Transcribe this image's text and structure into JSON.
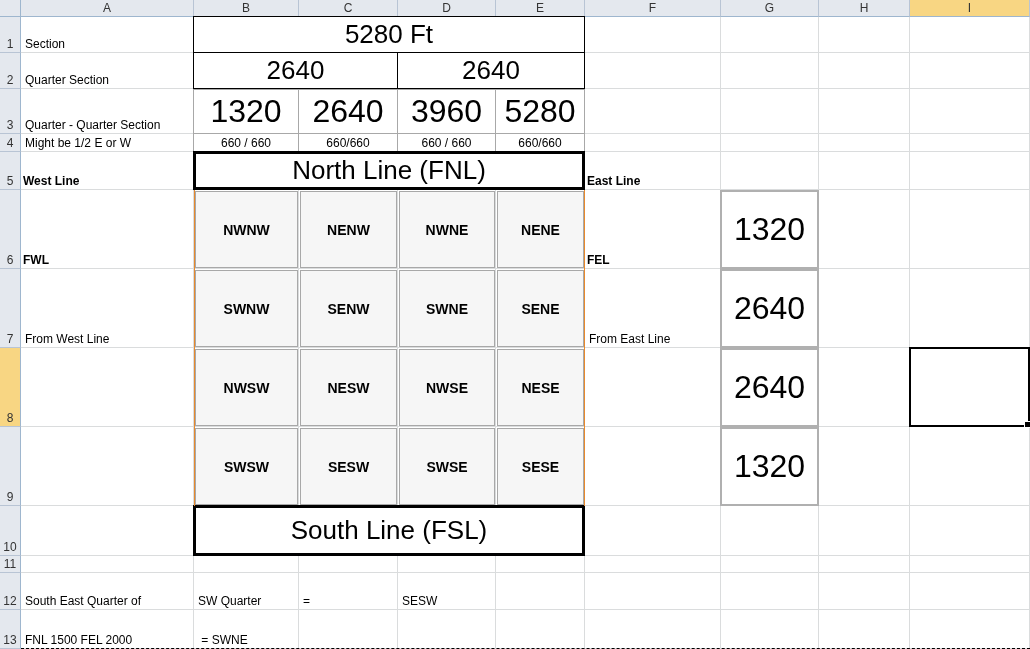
{
  "columns": [
    {
      "label": "A",
      "selected": false
    },
    {
      "label": "B",
      "selected": false
    },
    {
      "label": "C",
      "selected": false
    },
    {
      "label": "D",
      "selected": false
    },
    {
      "label": "E",
      "selected": false
    },
    {
      "label": "F",
      "selected": false
    },
    {
      "label": "G",
      "selected": false
    },
    {
      "label": "H",
      "selected": false
    },
    {
      "label": "I",
      "selected": true
    }
  ],
  "rows": [
    {
      "number": "1",
      "selected": false,
      "cells": [
        {
          "kind": "label",
          "text": "Section"
        },
        {
          "kind": "heading",
          "text": "5280 Ft"
        }
      ]
    },
    {
      "number": "2",
      "selected": false,
      "cells": [
        {
          "kind": "label",
          "text": "Quarter Section"
        },
        {
          "kind": "heading",
          "text": "2640"
        },
        {
          "kind": "heading",
          "text": "2640"
        }
      ]
    },
    {
      "number": "3",
      "selected": false,
      "cells": [
        {
          "kind": "label",
          "text": "Quarter - Quarter Section"
        },
        {
          "kind": "number",
          "text": "1320"
        },
        {
          "kind": "number",
          "text": "2640"
        },
        {
          "kind": "number",
          "text": "3960"
        },
        {
          "kind": "number",
          "text": "5280"
        }
      ]
    },
    {
      "number": "4",
      "selected": false,
      "cells": [
        {
          "kind": "label",
          "text": "Might be 1/2 E or W"
        },
        {
          "kind": "small",
          "text": "660 / 660"
        },
        {
          "kind": "small",
          "text": "660/660"
        },
        {
          "kind": "small",
          "text": "660 / 660"
        },
        {
          "kind": "small",
          "text": "660/660"
        }
      ]
    },
    {
      "number": "5",
      "selected": false,
      "cells": [
        {
          "kind": "bold",
          "text": "West Line"
        },
        {
          "kind": "banner",
          "text": "North Line (FNL)"
        },
        {
          "kind": "bold",
          "text": "East Line"
        }
      ]
    },
    {
      "number": "6",
      "selected": false,
      "cells": [
        {
          "kind": "bold",
          "text": "FWL"
        },
        {
          "kind": "quadrant",
          "text": "NWNW"
        },
        {
          "kind": "quadrant",
          "text": "NENW"
        },
        {
          "kind": "quadrant",
          "text": "NWNE"
        },
        {
          "kind": "quadrant",
          "text": "NENE"
        },
        {
          "kind": "bold",
          "text": "FEL"
        },
        {
          "kind": "measure",
          "text": "1320"
        }
      ]
    },
    {
      "number": "7",
      "selected": false,
      "cells": [
        {
          "kind": "label",
          "text": "From West Line"
        },
        {
          "kind": "quadrant",
          "text": "SWNW"
        },
        {
          "kind": "quadrant",
          "text": "SENW"
        },
        {
          "kind": "quadrant",
          "text": "SWNE"
        },
        {
          "kind": "quadrant",
          "text": "SENE"
        },
        {
          "kind": "label",
          "text": "From East Line"
        },
        {
          "kind": "measure",
          "text": "2640"
        }
      ]
    },
    {
      "number": "8",
      "selected": true,
      "cells": [
        {
          "kind": "quadrant",
          "text": "NWSW"
        },
        {
          "kind": "quadrant",
          "text": "NESW"
        },
        {
          "kind": "quadrant",
          "text": "NWSE"
        },
        {
          "kind": "quadrant",
          "text": "NESE"
        },
        {
          "kind": "measure",
          "text": "2640"
        }
      ]
    },
    {
      "number": "9",
      "selected": false,
      "cells": [
        {
          "kind": "quadrant",
          "text": "SWSW"
        },
        {
          "kind": "quadrant",
          "text": "SESW"
        },
        {
          "kind": "quadrant",
          "text": "SWSE"
        },
        {
          "kind": "quadrant",
          "text": "SESE"
        },
        {
          "kind": "measure",
          "text": "1320"
        }
      ]
    },
    {
      "number": "10",
      "selected": false,
      "cells": [
        {
          "kind": "banner",
          "text": "South Line (FSL)"
        }
      ]
    },
    {
      "number": "11",
      "selected": false,
      "cells": []
    },
    {
      "number": "12",
      "selected": false,
      "cells": [
        {
          "kind": "label",
          "text": "South East Quarter of"
        },
        {
          "kind": "label",
          "text": "SW Quarter"
        },
        {
          "kind": "label",
          "text": "="
        },
        {
          "kind": "label",
          "text": "SESW"
        }
      ]
    },
    {
      "number": "13",
      "selected": false,
      "cells": [
        {
          "kind": "label",
          "text": "FNL 1500 FEL 2000"
        },
        {
          "kind": "label",
          "text": " = SWNE"
        }
      ]
    }
  ]
}
